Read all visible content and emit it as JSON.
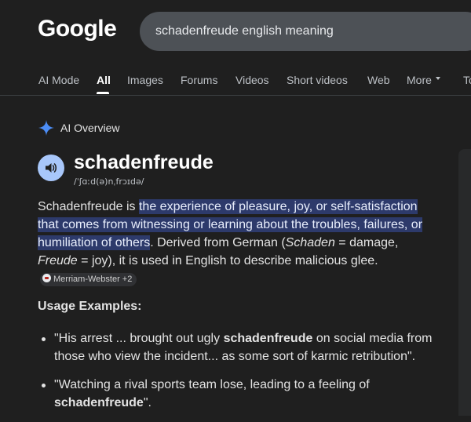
{
  "header": {
    "logo": "Google",
    "search_value": "schadenfreude english meaning"
  },
  "tabs": [
    {
      "label": "AI Mode",
      "active": false
    },
    {
      "label": "All",
      "active": true
    },
    {
      "label": "Images",
      "active": false
    },
    {
      "label": "Forums",
      "active": false
    },
    {
      "label": "Videos",
      "active": false
    },
    {
      "label": "Short videos",
      "active": false
    },
    {
      "label": "Web",
      "active": false
    },
    {
      "label": "More",
      "active": false
    },
    {
      "label": "Tools",
      "active": false
    }
  ],
  "ai_overview": {
    "label": "AI Overview",
    "headword": "schadenfreude",
    "pronunciation": "/ˈʃɑːd(ə)nˌfrɔɪdə/",
    "definition_intro": "Schadenfreude is ",
    "definition_highlight": "the experience of pleasure, joy, or self-satisfaction that comes from witnessing or learning about the troubles, failures, or humiliation of others",
    "definition_rest_1": ". Derived from German (",
    "schaden": "Schaden",
    "schaden_gloss": " = damage, ",
    "freude": "Freude",
    "freude_gloss": " = joy), it is used in English to describe malicious glee.",
    "source_chip": "Merriam-Webster +2",
    "usage_heading": "Usage Examples:",
    "examples": [
      {
        "before": "\"His arrest ... brought out ugly ",
        "bold": "schadenfreude",
        "after": " on social media from those who view the incident... as some sort of karmic retribution\"."
      },
      {
        "before": "\"Watching a rival sports team lose, leading to a feeling of ",
        "bold": "schadenfreude",
        "after": "\"."
      }
    ]
  },
  "colors": {
    "background": "#1f1f1f",
    "highlight": "#2d3a6b",
    "gemini_blue": "#4c8df6",
    "speaker": "#a8c7fa"
  }
}
